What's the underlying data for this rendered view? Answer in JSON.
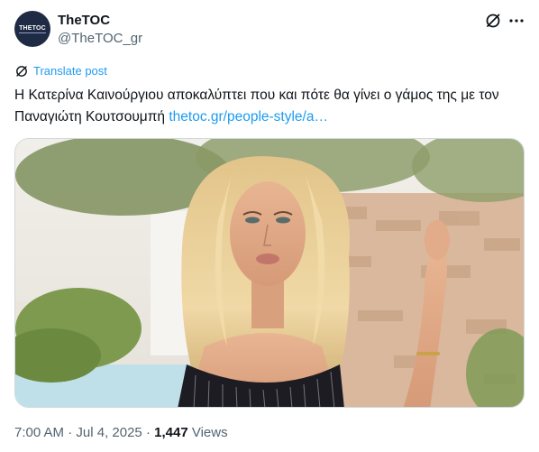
{
  "author": {
    "avatar_text": "THETOC",
    "name": "TheTOC",
    "handle": "@TheTOC_gr"
  },
  "actions": {
    "grok_icon": "grok-slash-icon",
    "more_icon": "more-horizontal-icon"
  },
  "translate": {
    "icon": "translate-globe-icon",
    "label": "Translate post"
  },
  "tweet": {
    "text": "Η Κατερίνα Καινούργιου αποκαλύπτει που και πότε θα γίνει ο γάμος της με τον Παναγιώτη Κουτσουμπή ",
    "link": "thetoc.gr/people-style/a…"
  },
  "meta": {
    "time": "7:00 AM",
    "separator1": " · ",
    "date": "Jul 4, 2025",
    "separator2": " · ",
    "views_count": "1,447",
    "views_label": " Views"
  },
  "colors": {
    "link": "#1d9bf0",
    "secondary_text": "#536471",
    "primary_text": "#0f1419",
    "border": "#cfd9de"
  }
}
